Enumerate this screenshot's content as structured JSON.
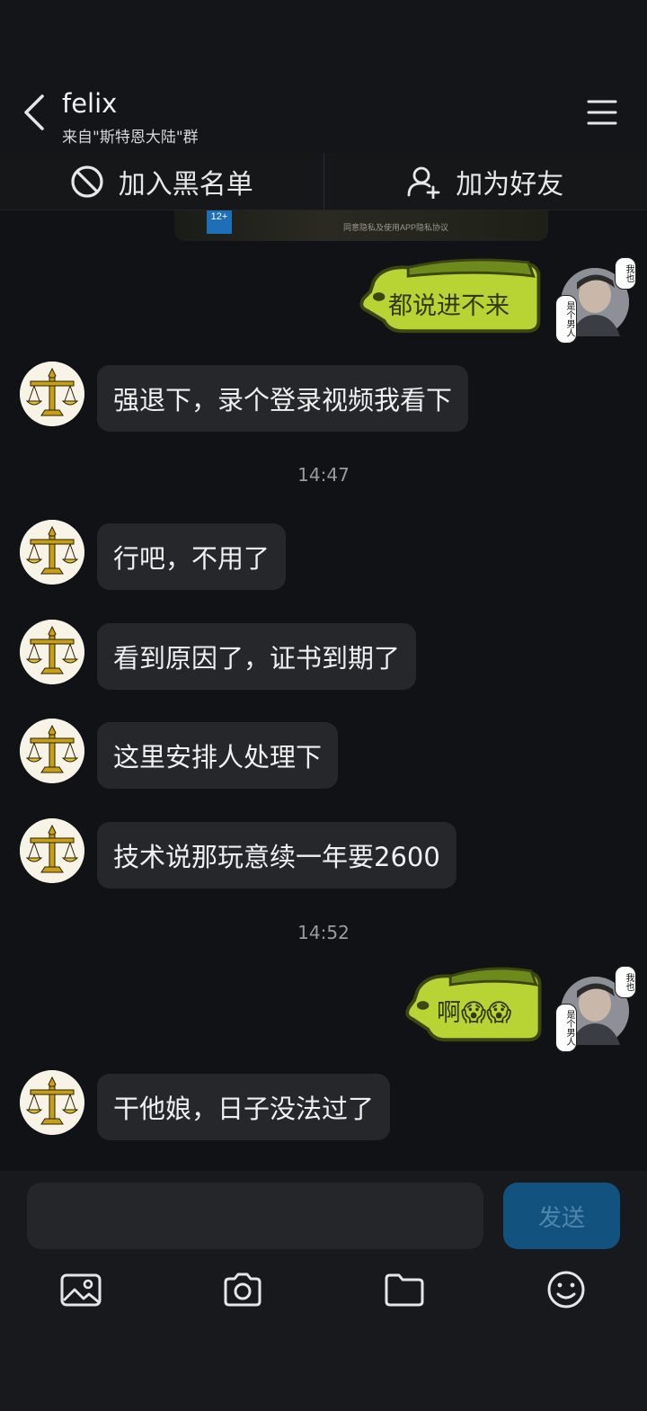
{
  "header": {
    "contact_name": "felix",
    "contact_subtitle": "来自\"斯特恩大陆\"群"
  },
  "actions": {
    "blacklist_label": "加入黑名单",
    "add_friend_label": "加为好友"
  },
  "media_card": {
    "age_badge": "12+",
    "age_sub": "适龄提示",
    "caption": "同意隐私及使用APP隐私协议"
  },
  "messages": [
    {
      "side": "right",
      "type": "sticker",
      "text": "都说进不来",
      "avatar_caption_top": "我也",
      "avatar_caption_side": "是个男人"
    },
    {
      "side": "left",
      "type": "text",
      "text": "强退下，录个登录视频我看下"
    },
    {
      "type": "time",
      "text": "14:47"
    },
    {
      "side": "left",
      "type": "text",
      "text": "行吧，不用了"
    },
    {
      "side": "left",
      "type": "text",
      "text": "看到原因了，证书到期了"
    },
    {
      "side": "left",
      "type": "text",
      "text": "这里安排人处理下"
    },
    {
      "side": "left",
      "type": "text",
      "text": "技术说那玩意续一年要2600"
    },
    {
      "type": "time",
      "text": "14:52"
    },
    {
      "side": "right",
      "type": "sticker",
      "text": "啊😱😱",
      "avatar_caption_top": "我也",
      "avatar_caption_side": "是个男人"
    },
    {
      "side": "left",
      "type": "text",
      "text": "干他娘，日子没法过了"
    }
  ],
  "composer": {
    "input_value": "",
    "send_label": "发送"
  },
  "toolbar": {
    "icons": [
      "image-icon",
      "camera-icon",
      "folder-icon",
      "emoji-icon"
    ]
  },
  "colors": {
    "background": "#111215",
    "bubble_left": "#26272b",
    "sticker_green": "#b8d434",
    "send_button": "#11527e"
  }
}
